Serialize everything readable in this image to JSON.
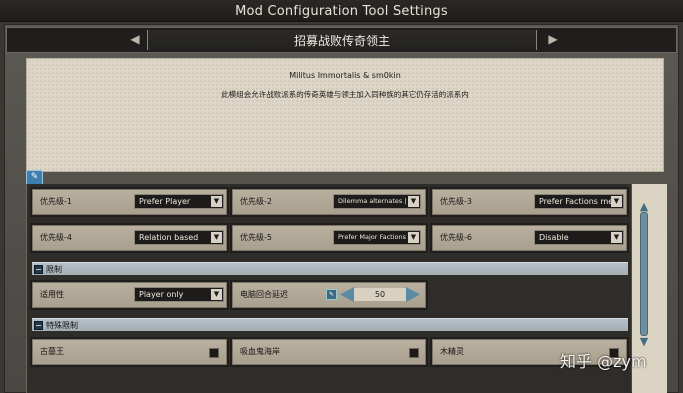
{
  "window": {
    "title": "Mod Configuration Tool Settings"
  },
  "header": {
    "title": "招募战败传奇领主"
  },
  "description": {
    "line1": "Militus Immortalis & sm0kin",
    "line2": "此模组会允许战败派系的传奇英雄与领主加入同种族的其它仍存活的派系内"
  },
  "priorities": [
    {
      "label": "优先级-1",
      "value": "Prefer Player"
    },
    {
      "label": "优先级-2",
      "value": "Dilemma alternates | ---"
    },
    {
      "label": "优先级-3",
      "value": "Prefer Factions met"
    },
    {
      "label": "优先级-4",
      "value": "Relation based"
    },
    {
      "label": "优先级-5",
      "value": "Prefer Major Factions"
    },
    {
      "label": "优先级-6",
      "value": "Disable"
    }
  ],
  "sections": {
    "limits": {
      "label": "限制",
      "toggle": "−"
    },
    "special": {
      "label": "特殊限制",
      "toggle": "−"
    }
  },
  "limits": {
    "applicability_label": "适用性",
    "applicability_value": "Player only",
    "ai_turn_label": "电脑回合延迟",
    "ai_turn_value": "50"
  },
  "special": [
    {
      "label": "古墓王",
      "checked": false
    },
    {
      "label": "吸血鬼海岸",
      "checked": false
    },
    {
      "label": "木精灵",
      "checked": false
    }
  ],
  "watermark": "知乎 @zym",
  "icons": {
    "edit": "pencil-icon",
    "dropdown": "caret-down-icon",
    "scroll_up": "arrow-up-icon",
    "scroll_down": "arrow-down-icon",
    "header_left": "back-arrow-icon",
    "header_right": "forward-arrow-icon"
  }
}
